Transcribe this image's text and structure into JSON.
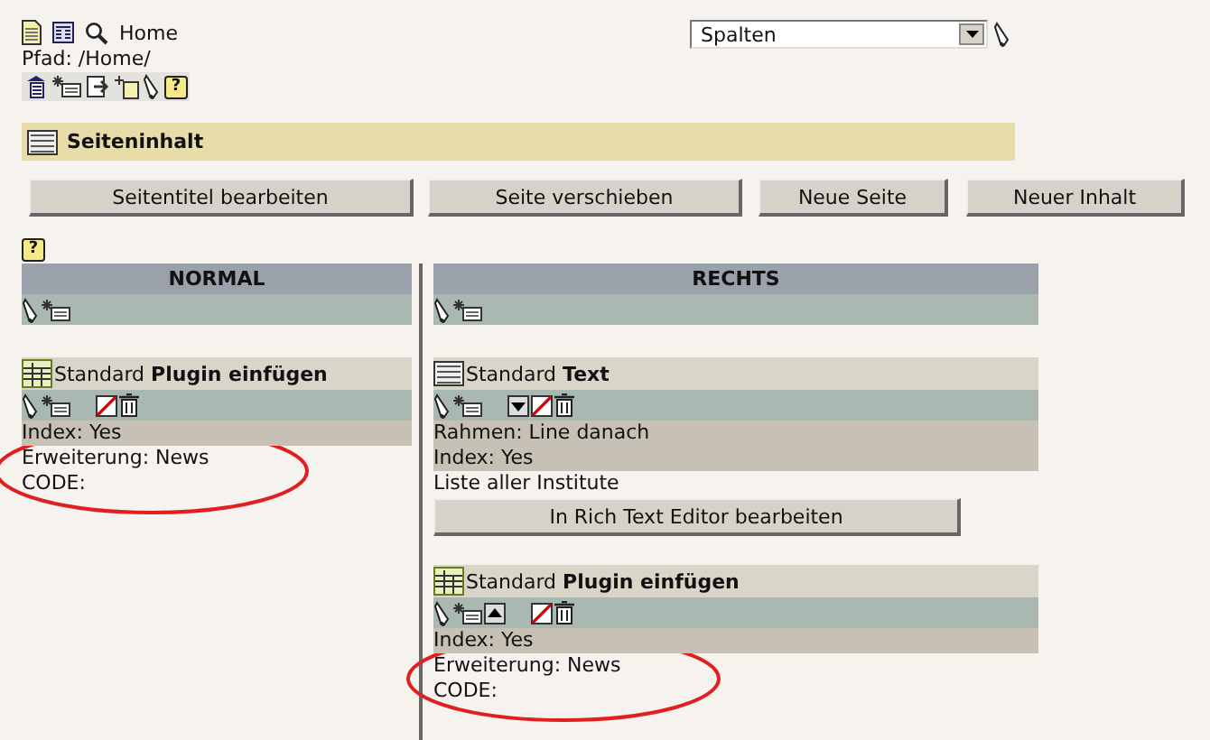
{
  "header": {
    "title": "Home",
    "path": "Pfad: /Home/",
    "help": "?"
  },
  "view_select": {
    "value": "Spalten"
  },
  "section": {
    "title": "Seiteninhalt"
  },
  "buttons": [
    "Seitentitel bearbeiten",
    "Seite verschieben",
    "Neue Seite",
    "Neuer Inhalt"
  ],
  "help": "?",
  "columns": [
    {
      "title": "NORMAL",
      "elements": [
        {
          "kind": "plugin",
          "prefix": "Standard",
          "title": "Plugin einfügen",
          "move_up": false,
          "move_down": false,
          "fields": [
            "Index: Yes"
          ],
          "details": [
            "Erweiterung: News",
            "CODE:"
          ],
          "circled": true
        }
      ]
    },
    {
      "title": "RECHTS",
      "elements": [
        {
          "kind": "text",
          "prefix": "Standard",
          "title": "Text",
          "move_up": false,
          "move_down": true,
          "fields": [
            "Rahmen: Line danach",
            "Index: Yes"
          ],
          "body": [
            "Liste aller Institute"
          ],
          "button": "In Rich Text Editor bearbeiten"
        },
        {
          "kind": "plugin",
          "prefix": "Standard",
          "title": "Plugin einfügen",
          "move_up": true,
          "move_down": false,
          "fields": [
            "Index: Yes"
          ],
          "details": [
            "Erweiterung: News",
            "CODE:"
          ],
          "circled": true
        }
      ]
    }
  ]
}
